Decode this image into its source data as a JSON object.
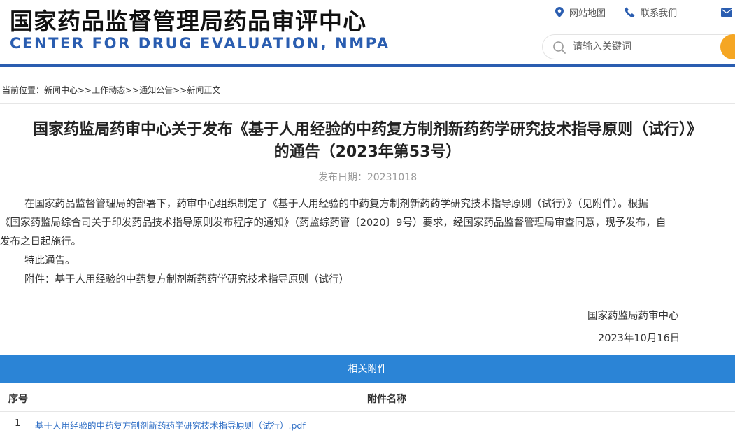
{
  "header": {
    "logo_cn": "国家药品监督管理局药品审评中心",
    "logo_en": "CENTER FOR DRUG EVALUATION, NMPA",
    "links": {
      "sitemap": "网站地图",
      "contact": "联系我们"
    },
    "search": {
      "placeholder": "请输入关键词"
    },
    "accent_color": "#2a5db0",
    "search_button_color": "#f5a623"
  },
  "breadcrumb": "当前位置：新闻中心>>工作动态>>通知公告>>新闻正文",
  "article": {
    "title_line1": "国家药监局药审中心关于发布《基于人用经验的中药复方制剂新药药学研究技术指导原则（试行）》",
    "title_line2": "的通告（2023年第53号）",
    "pub_date": "发布日期：20231018",
    "para1_line1": "在国家药品监督管理局的部署下，药审中心组织制定了《基于人用经验的中药复方制剂新药药学研究技术指导原则（试行）》（见附件）。根据",
    "para1_line2": "《国家药监局综合司关于印发药品技术指导原则发布程序的通知》（药监综药管〔2020〕9号）要求，经国家药品监督管理局审查同意，现予发布，自",
    "para1_line3": "发布之日起施行。",
    "para2": "特此通告。",
    "para3": "附件：基于人用经验的中药复方制剂新药药学研究技术指导原则（试行）",
    "signature": "国家药监局药审中心",
    "sign_date": "2023年10月16日"
  },
  "attachments": {
    "header": "相关附件",
    "header_color": "#2b84d6",
    "col_no": "序号",
    "col_name": "附件名称",
    "rows": [
      {
        "no": "1",
        "name": "基于人用经验的中药复方制剂新药药学研究技术指导原则（试行）.pdf"
      }
    ]
  }
}
